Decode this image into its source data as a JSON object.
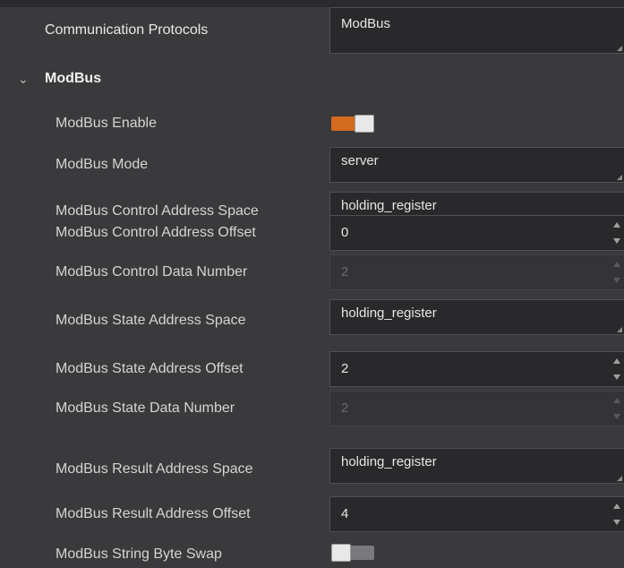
{
  "communication": {
    "label": "Communication Protocols",
    "value": "ModBus"
  },
  "section": {
    "title": "ModBus",
    "chevron": "chevron-down-icon"
  },
  "rows": {
    "enable": {
      "label": "ModBus Enable",
      "state": "on",
      "accent": "#d46a1e"
    },
    "mode": {
      "label": "ModBus Mode",
      "value": "server"
    },
    "ctrl_space": {
      "label": "ModBus Control Address Space",
      "value": "holding_register"
    },
    "ctrl_offset": {
      "label": "ModBus Control Address Offset",
      "value": "0"
    },
    "ctrl_number": {
      "label": "ModBus Control Data Number",
      "value": "2"
    },
    "state_space": {
      "label": "ModBus State Address Space",
      "value": "holding_register"
    },
    "state_offset": {
      "label": "ModBus State Address Offset",
      "value": "2"
    },
    "state_number": {
      "label": "ModBus State Data Number",
      "value": "2"
    },
    "result_space": {
      "label": "ModBus Result Address Space",
      "value": "holding_register"
    },
    "result_offset": {
      "label": "ModBus Result Address Offset",
      "value": "4"
    },
    "byte_swap": {
      "label": "ModBus String Byte Swap",
      "state": "off"
    }
  }
}
